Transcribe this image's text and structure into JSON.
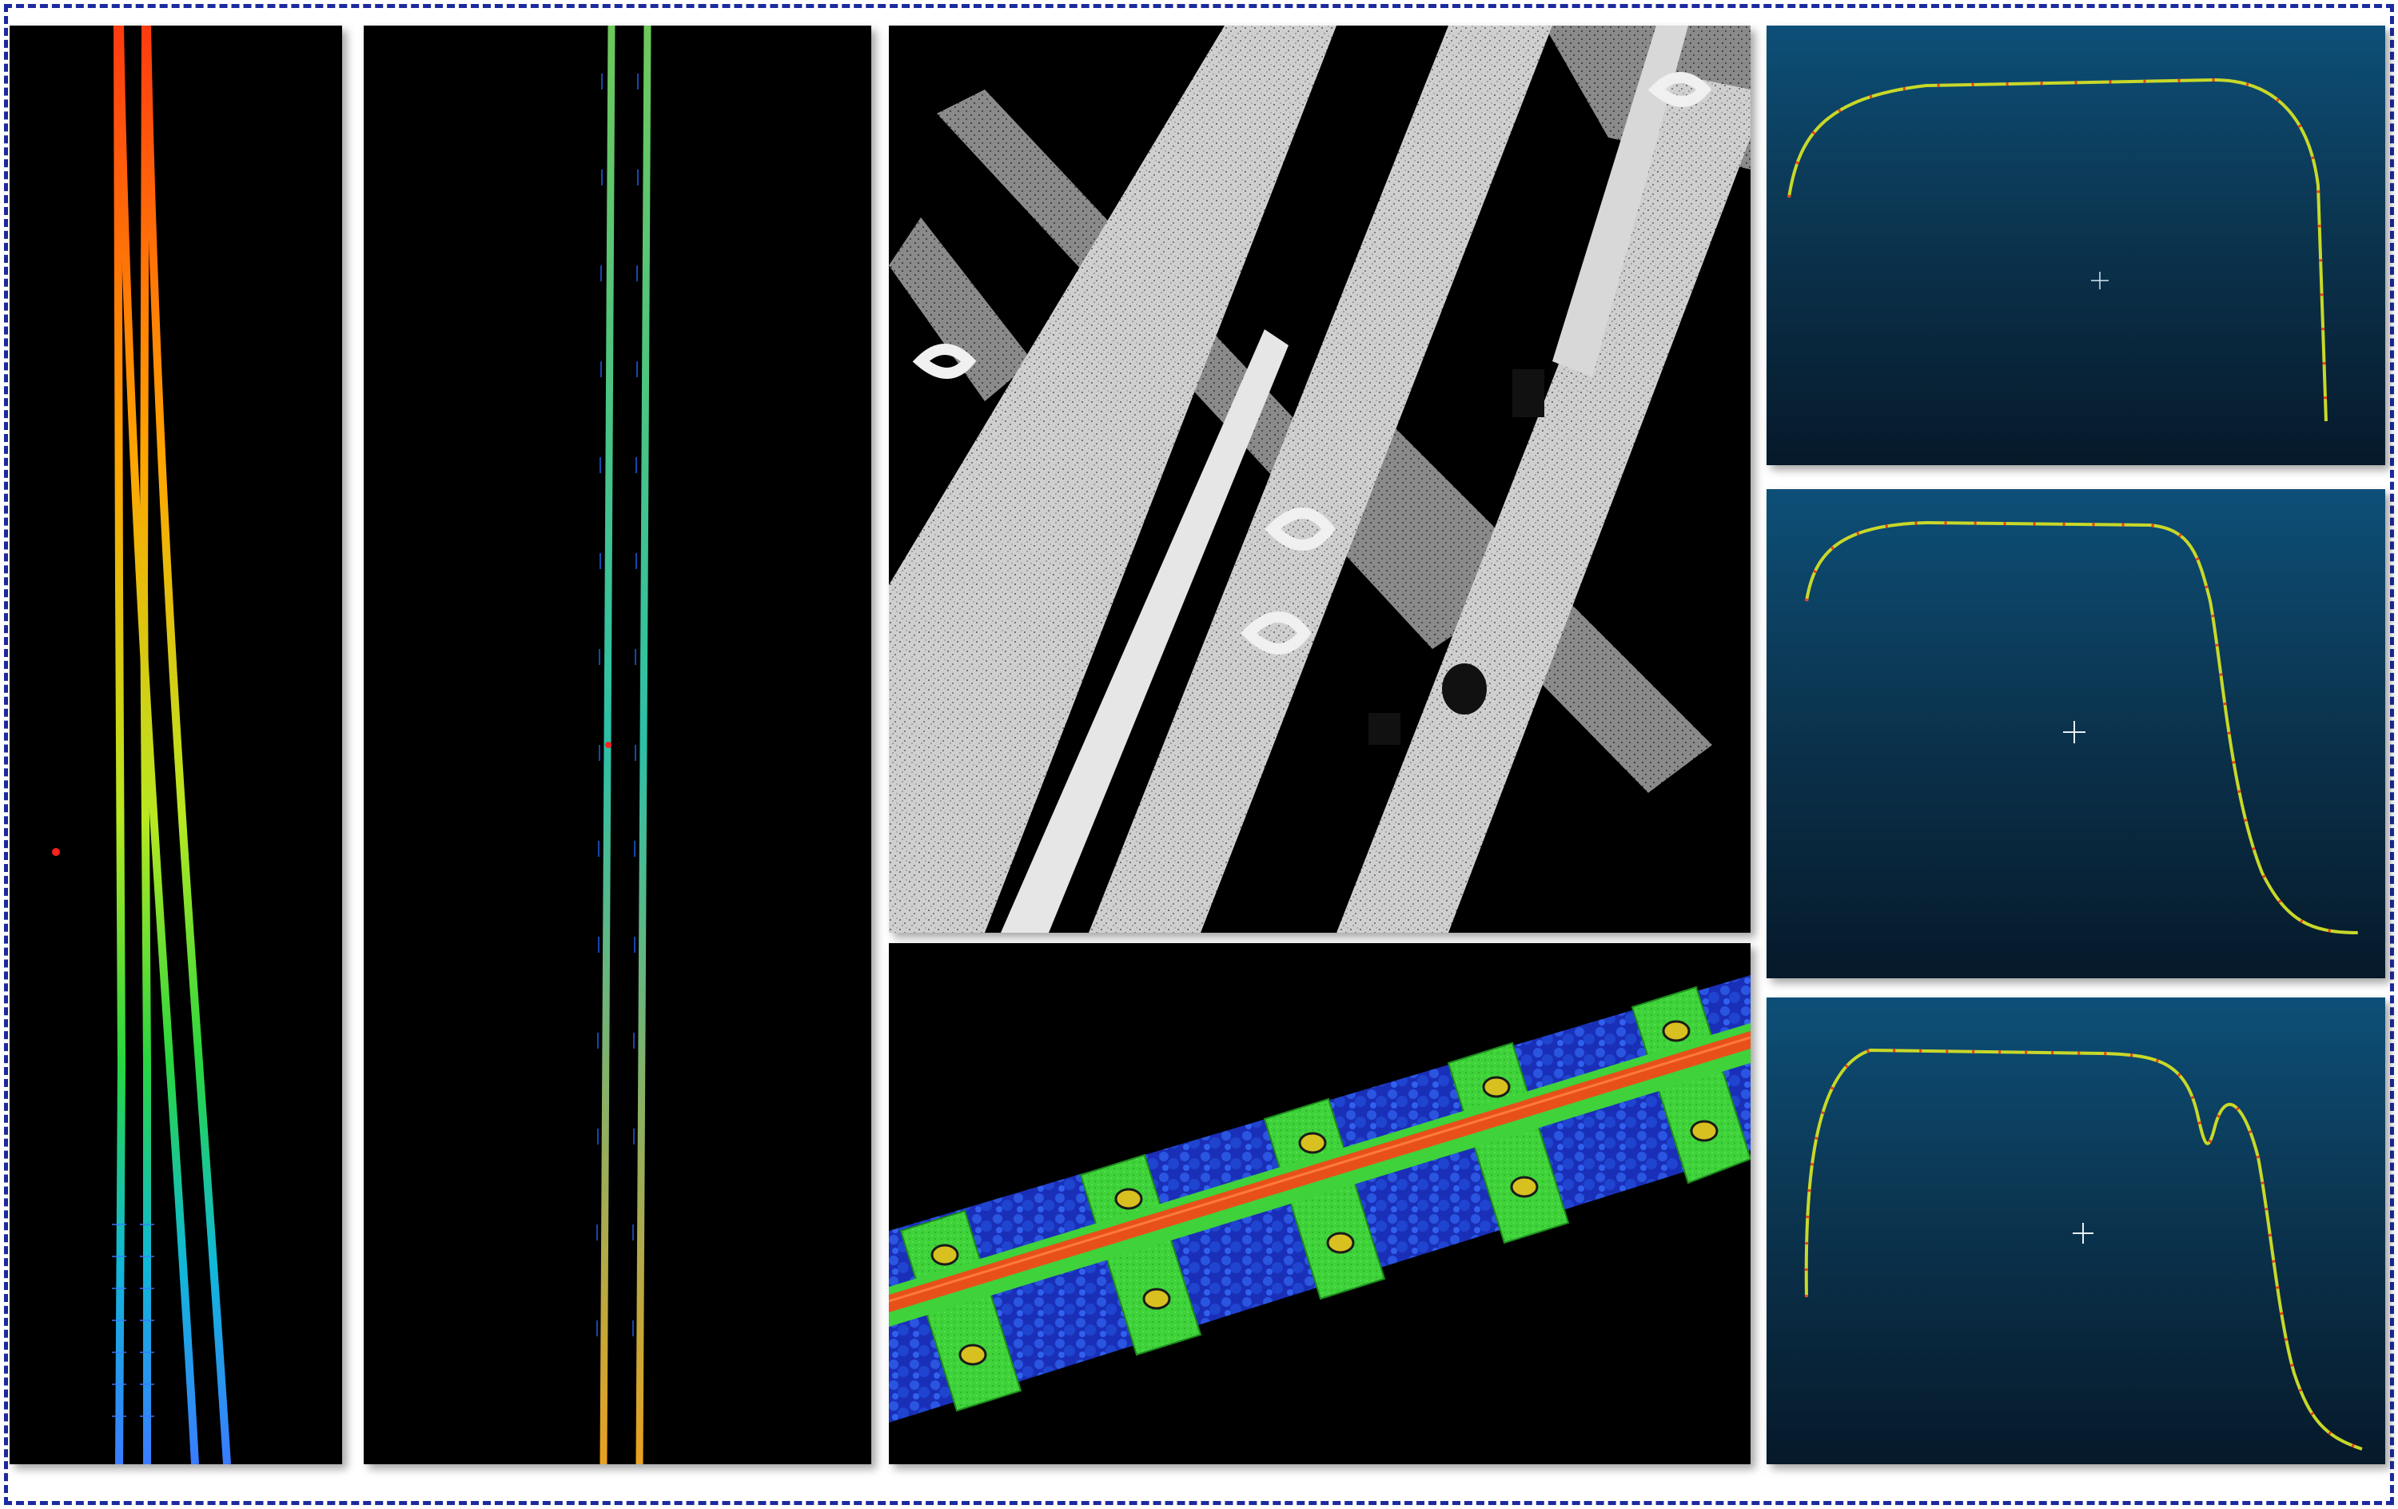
{
  "figure": {
    "panels": [
      {
        "id": "a",
        "content": "point-cloud-top-view-diverging-rails",
        "colormap": "height-rainbow"
      },
      {
        "id": "b",
        "content": "point-cloud-top-view-parallel-rails",
        "colormap": "height-rainbow"
      },
      {
        "id": "c",
        "content": "grayscale-intensity-point-cloud-turnout-closeup"
      },
      {
        "id": "d",
        "content": "colored-point-cloud-rail-sleepers-ballast"
      },
      {
        "id": "e",
        "content": "rail-head-profile-cross-section-1"
      },
      {
        "id": "f",
        "content": "rail-head-profile-cross-section-2"
      },
      {
        "id": "g",
        "content": "rail-head-profile-cross-section-3"
      }
    ],
    "colors": {
      "frame": "#1c2a9e",
      "profile_background_top": "#0d4f78",
      "profile_background_bottom": "#06192a",
      "rail_orange": "#e8501a",
      "sleeper_green": "#3fd23a",
      "ballast_blue": "#1f3fd0"
    }
  }
}
